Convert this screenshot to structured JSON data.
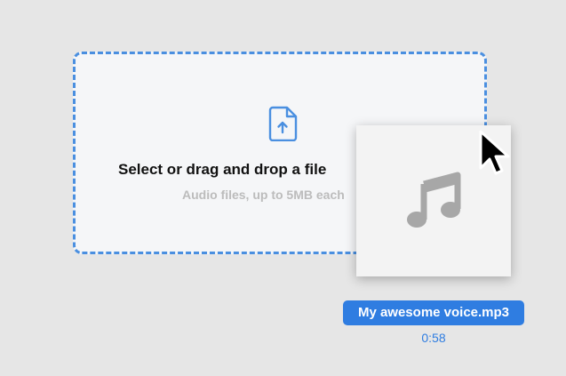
{
  "colors": {
    "accent": "#2f7de1",
    "dashed_border": "#4a8fe0",
    "dropzone_bg": "#f5f6f8",
    "title_text": "#111111",
    "subtitle_text": "#bcbcbc",
    "page_bg": "#e6e6e6",
    "card_bg": "#f3f3f3",
    "music_icon": "#a7a7a7"
  },
  "dropzone": {
    "icon": "file-upload-icon",
    "title": "Select or drag and drop a file",
    "subtitle": "Audio files, up to 5MB each"
  },
  "drag_preview": {
    "icon": "music-note-icon",
    "file_name": "My awesome voice.mp3",
    "duration": "0:58"
  },
  "cursor": {
    "icon": "arrow-cursor-icon"
  }
}
